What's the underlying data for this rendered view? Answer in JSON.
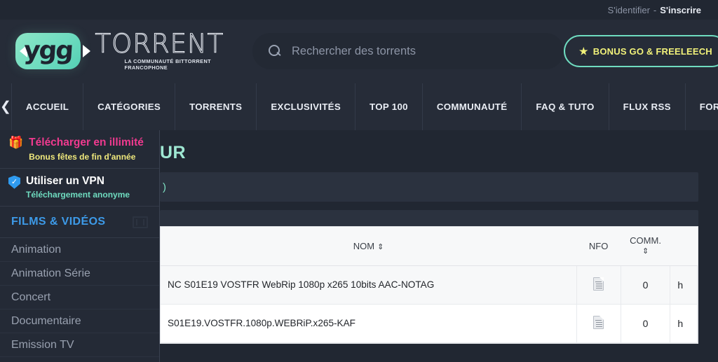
{
  "topbar": {
    "login_label": "S'identifier",
    "separator": "-",
    "register_label": "S'inscrire"
  },
  "header": {
    "logo_mark": "ygg",
    "logo_word": "TORRENT",
    "logo_tagline": "LA COMMUNAUTÉ BITTORRENT FRANCOPHONE",
    "search_placeholder": "Rechercher des torrents",
    "search_value": "",
    "bonus_star": "★",
    "bonus_label": "BONUS GO & FREELEECH"
  },
  "nav": {
    "back_arrow": "❮",
    "items": [
      {
        "label": "ACCUEIL"
      },
      {
        "label": "CATÉGORIES"
      },
      {
        "label": "TORRENTS"
      },
      {
        "label": "EXCLUSIVITÉS"
      },
      {
        "label": "TOP 100"
      },
      {
        "label": "COMMUNAUTÉ"
      },
      {
        "label": "FAQ & TUTO"
      },
      {
        "label": "FLUX RSS"
      },
      {
        "label": "FORUM"
      }
    ]
  },
  "sidebar": {
    "promos": [
      {
        "icon": "gift-icon",
        "glyph": "🎁",
        "title": "Télécharger en illimité",
        "subtitle": "Bonus fêtes de fin d'année"
      },
      {
        "icon": "shield-check-icon",
        "glyph": "",
        "title": "Utiliser un VPN",
        "subtitle": "Téléchargement anonyme"
      }
    ],
    "category_header": "FILMS & VIDÉOS",
    "category_icon": "film-strip-icon",
    "items": [
      {
        "label": "Animation"
      },
      {
        "label": "Animation Série"
      },
      {
        "label": "Concert"
      },
      {
        "label": "Documentaire"
      },
      {
        "label": "Emission TV"
      }
    ]
  },
  "main": {
    "page_title": "UR",
    "panel_one_text": ")",
    "panel_two_text": ""
  },
  "table": {
    "columns": [
      {
        "key": "name",
        "label": "NOM",
        "sortable": true,
        "sort_glyph": "⇕"
      },
      {
        "key": "nfo",
        "label": "NFO",
        "sortable": false,
        "sort_glyph": ""
      },
      {
        "key": "comm",
        "label": "COMM.",
        "sortable": true,
        "sort_glyph": "⇕"
      },
      {
        "key": "extra",
        "label": "",
        "sortable": false,
        "sort_glyph": ""
      }
    ],
    "rows": [
      {
        "name": "NC S01E19 VOSTFR WebRip 1080p x265 10bits AAC-NOTAG",
        "nfo_icon": "nfo-file-icon",
        "comm": "0",
        "extra": "h"
      },
      {
        "name": "S01E19.VOSTFR.1080p.WEBRiP.x265-KAF",
        "nfo_icon": "nfo-file-icon",
        "comm": "0",
        "extra": "h"
      }
    ]
  },
  "colors": {
    "page_bg": "#212732",
    "panel_bg": "#262c38",
    "accent_mint": "#6fdcc0",
    "accent_yellow": "#f2f27a",
    "accent_pink": "#f03a8f",
    "accent_blue": "#3d9ae8",
    "table_bg": "#ffffff"
  }
}
